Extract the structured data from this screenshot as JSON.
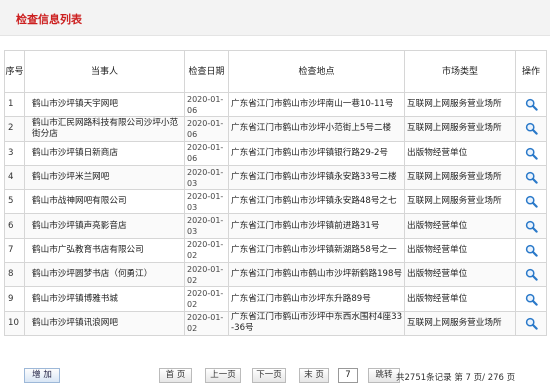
{
  "header": {
    "title": "检查信息列表"
  },
  "table": {
    "columns": {
      "no": "序号",
      "party": "当事人",
      "date": "检查日期",
      "address": "检查地点",
      "type": "市场类型",
      "op": "操作"
    },
    "rows": [
      {
        "no": "1",
        "party": "鹤山市沙坪镇天宇网吧",
        "date": "2020-01-06",
        "address": "广东省江门市鹤山市沙坪南山一巷10-11号",
        "type": "互联网上网服务营业场所"
      },
      {
        "no": "2",
        "party": "鹤山市汇民网路科技有限公司沙坪小范街分店",
        "date": "2020-01-06",
        "address": "广东省江门市鹤山市沙坪小范街上5号二楼",
        "type": "互联网上网服务营业场所"
      },
      {
        "no": "3",
        "party": "鹤山市沙坪镇日新商店",
        "date": "2020-01-06",
        "address": "广东省江门市鹤山市沙坪镇银行路29-2号",
        "type": "出版物经营单位"
      },
      {
        "no": "4",
        "party": "鹤山市沙坪米兰网吧",
        "date": "2020-01-03",
        "address": "广东省江门市鹤山市沙坪镇永安路33号二楼",
        "type": "互联网上网服务营业场所"
      },
      {
        "no": "5",
        "party": "鹤山市战神网吧有限公司",
        "date": "2020-01-03",
        "address": "广东省江门市鹤山市沙坪镇永安路48号之七",
        "type": "互联网上网服务营业场所"
      },
      {
        "no": "6",
        "party": "鹤山市沙坪镇声亮影音店",
        "date": "2020-01-03",
        "address": "广东省江门市鹤山市沙坪镇前进路31号",
        "type": "出版物经营单位"
      },
      {
        "no": "7",
        "party": "鹤山市广弘教育书店有限公司",
        "date": "2020-01-02",
        "address": "广东省江门市鹤山市沙坪镇新湖路58号之一",
        "type": "出版物经营单位"
      },
      {
        "no": "8",
        "party": "鹤山市沙坪圆梦书店（何勇江）",
        "date": "2020-01-02",
        "address": "广东省江门市鹤山市鹤山市沙坪新鹤路198号",
        "type": "出版物经营单位"
      },
      {
        "no": "9",
        "party": "鹤山市沙坪镇博雅书城",
        "date": "2020-01-02",
        "address": "广东省江门市鹤山市沙坪东升路89号",
        "type": "出版物经营单位"
      },
      {
        "no": "10",
        "party": "鹤山市沙坪镇讯浪网吧",
        "date": "2020-01-02",
        "address": "广东省江门市鹤山市沙坪中东西水围村4座33-36号",
        "type": "互联网上网服务营业场所"
      }
    ]
  },
  "footer": {
    "add_label": "增 加",
    "first_label": "首 页",
    "prev_label": "上一页",
    "next_label": "下一页",
    "last_label": "末 页",
    "page_value": "7",
    "go_label": "跳转",
    "summary": "共2751条记录 第 7 页/ 276 页"
  },
  "icons": {
    "op": "magnifier-icon"
  },
  "colors": {
    "title": "#cc1f1f",
    "magnifier": "#2a79c9"
  }
}
